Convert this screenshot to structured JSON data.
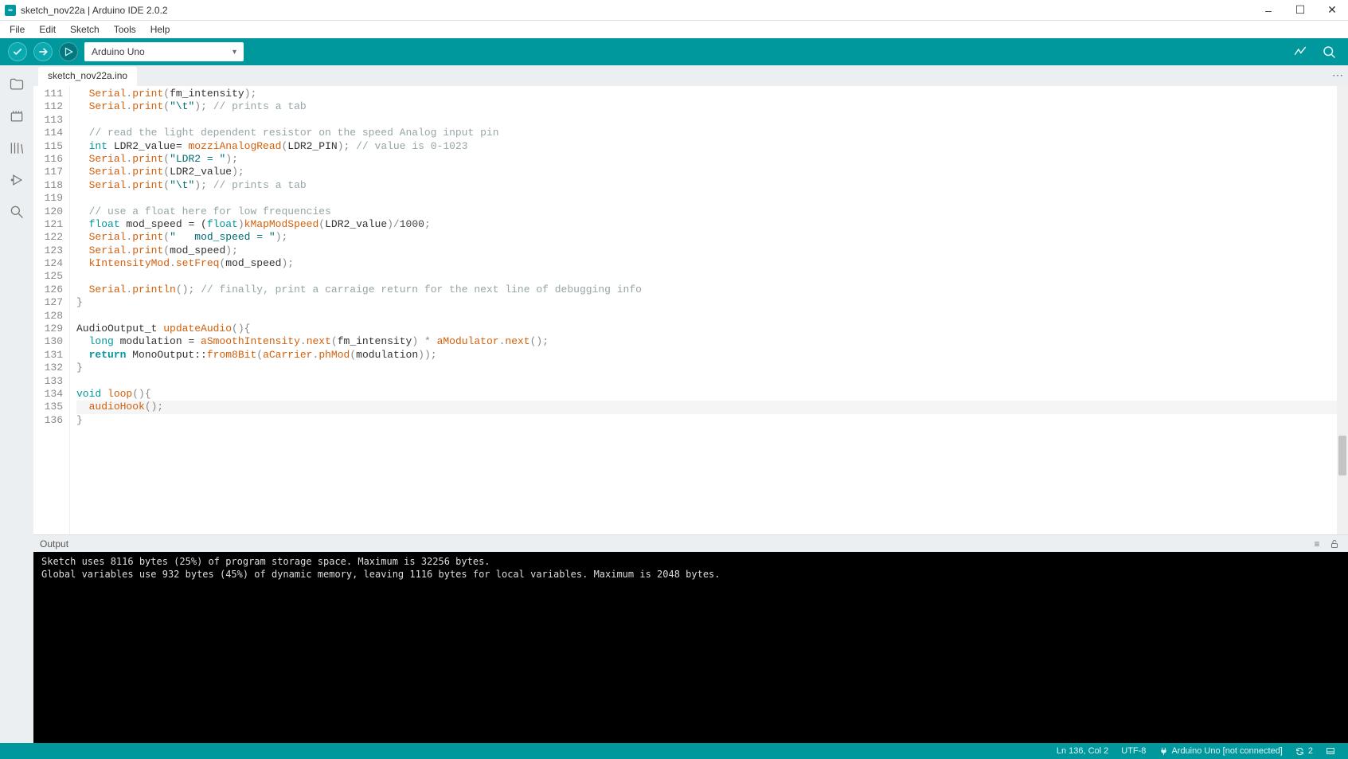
{
  "titlebar": {
    "title": "sketch_nov22a | Arduino IDE 2.0.2"
  },
  "menubar": {
    "items": [
      "File",
      "Edit",
      "Sketch",
      "Tools",
      "Help"
    ]
  },
  "toolbar": {
    "board_selected": "Arduino Uno"
  },
  "tabs": {
    "active": "sketch_nov22a.ino"
  },
  "editor": {
    "first_line": 111,
    "lines": [
      [
        {
          "t": "guide"
        },
        {
          "t": "fn",
          "s": "Serial"
        },
        {
          "t": "op",
          "s": "."
        },
        {
          "t": "fn",
          "s": "print"
        },
        {
          "t": "op",
          "s": "("
        },
        {
          "t": "ident",
          "s": "fm_intensity"
        },
        {
          "t": "op",
          "s": ");"
        }
      ],
      [
        {
          "t": "guide"
        },
        {
          "t": "fn",
          "s": "Serial"
        },
        {
          "t": "op",
          "s": "."
        },
        {
          "t": "fn",
          "s": "print"
        },
        {
          "t": "op",
          "s": "("
        },
        {
          "t": "str",
          "s": "\"\\t\""
        },
        {
          "t": "op",
          "s": "); "
        },
        {
          "t": "cmt",
          "s": "// prints a tab"
        }
      ],
      [
        {
          "t": "ident",
          "s": ""
        }
      ],
      [
        {
          "t": "guide"
        },
        {
          "t": "cmt",
          "s": "// read the light dependent resistor on the speed Analog input pin"
        }
      ],
      [
        {
          "t": "guide"
        },
        {
          "t": "type",
          "s": "int"
        },
        {
          "t": "ident",
          "s": " LDR2_value= "
        },
        {
          "t": "fn",
          "s": "mozziAnalogRead"
        },
        {
          "t": "op",
          "s": "("
        },
        {
          "t": "ident",
          "s": "LDR2_PIN"
        },
        {
          "t": "op",
          "s": "); "
        },
        {
          "t": "cmt",
          "s": "// value is 0-1023"
        }
      ],
      [
        {
          "t": "guide"
        },
        {
          "t": "fn",
          "s": "Serial"
        },
        {
          "t": "op",
          "s": "."
        },
        {
          "t": "fn",
          "s": "print"
        },
        {
          "t": "op",
          "s": "("
        },
        {
          "t": "str",
          "s": "\"LDR2 = \""
        },
        {
          "t": "op",
          "s": ");"
        }
      ],
      [
        {
          "t": "guide"
        },
        {
          "t": "fn",
          "s": "Serial"
        },
        {
          "t": "op",
          "s": "."
        },
        {
          "t": "fn",
          "s": "print"
        },
        {
          "t": "op",
          "s": "("
        },
        {
          "t": "ident",
          "s": "LDR2_value"
        },
        {
          "t": "op",
          "s": ");"
        }
      ],
      [
        {
          "t": "guide"
        },
        {
          "t": "fn",
          "s": "Serial"
        },
        {
          "t": "op",
          "s": "."
        },
        {
          "t": "fn",
          "s": "print"
        },
        {
          "t": "op",
          "s": "("
        },
        {
          "t": "str",
          "s": "\"\\t\""
        },
        {
          "t": "op",
          "s": "); "
        },
        {
          "t": "cmt",
          "s": "// prints a tab"
        }
      ],
      [
        {
          "t": "ident",
          "s": ""
        }
      ],
      [
        {
          "t": "guide"
        },
        {
          "t": "cmt",
          "s": "// use a float here for low frequencies"
        }
      ],
      [
        {
          "t": "guide"
        },
        {
          "t": "type",
          "s": "float"
        },
        {
          "t": "ident",
          "s": " mod_speed = ("
        },
        {
          "t": "type",
          "s": "float"
        },
        {
          "t": "op",
          "s": ")"
        },
        {
          "t": "fn",
          "s": "kMapModSpeed"
        },
        {
          "t": "op",
          "s": "("
        },
        {
          "t": "ident",
          "s": "LDR2_value"
        },
        {
          "t": "op",
          "s": ")/"
        },
        {
          "t": "num",
          "s": "1000"
        },
        {
          "t": "op",
          "s": ";"
        }
      ],
      [
        {
          "t": "guide"
        },
        {
          "t": "fn",
          "s": "Serial"
        },
        {
          "t": "op",
          "s": "."
        },
        {
          "t": "fn",
          "s": "print"
        },
        {
          "t": "op",
          "s": "("
        },
        {
          "t": "str",
          "s": "\"   mod_speed = \""
        },
        {
          "t": "op",
          "s": ");"
        }
      ],
      [
        {
          "t": "guide"
        },
        {
          "t": "fn",
          "s": "Serial"
        },
        {
          "t": "op",
          "s": "."
        },
        {
          "t": "fn",
          "s": "print"
        },
        {
          "t": "op",
          "s": "("
        },
        {
          "t": "ident",
          "s": "mod_speed"
        },
        {
          "t": "op",
          "s": ");"
        }
      ],
      [
        {
          "t": "guide"
        },
        {
          "t": "fn",
          "s": "kIntensityMod"
        },
        {
          "t": "op",
          "s": "."
        },
        {
          "t": "fn",
          "s": "setFreq"
        },
        {
          "t": "op",
          "s": "("
        },
        {
          "t": "ident",
          "s": "mod_speed"
        },
        {
          "t": "op",
          "s": ");"
        }
      ],
      [
        {
          "t": "ident",
          "s": ""
        }
      ],
      [
        {
          "t": "guide"
        },
        {
          "t": "fn",
          "s": "Serial"
        },
        {
          "t": "op",
          "s": "."
        },
        {
          "t": "fn",
          "s": "println"
        },
        {
          "t": "op",
          "s": "(); "
        },
        {
          "t": "cmt",
          "s": "// finally, print a carraige return for the next line of debugging info"
        }
      ],
      [
        {
          "t": "op",
          "s": "}"
        }
      ],
      [
        {
          "t": "ident",
          "s": ""
        }
      ],
      [
        {
          "t": "ident",
          "s": "AudioOutput_t "
        },
        {
          "t": "fn",
          "s": "updateAudio"
        },
        {
          "t": "op",
          "s": "(){"
        }
      ],
      [
        {
          "t": "guide"
        },
        {
          "t": "type",
          "s": "long"
        },
        {
          "t": "ident",
          "s": " modulation = "
        },
        {
          "t": "fn",
          "s": "aSmoothIntensity"
        },
        {
          "t": "op",
          "s": "."
        },
        {
          "t": "fn",
          "s": "next"
        },
        {
          "t": "op",
          "s": "("
        },
        {
          "t": "ident",
          "s": "fm_intensity"
        },
        {
          "t": "op",
          "s": ") * "
        },
        {
          "t": "fn",
          "s": "aModulator"
        },
        {
          "t": "op",
          "s": "."
        },
        {
          "t": "fn",
          "s": "next"
        },
        {
          "t": "op",
          "s": "();"
        }
      ],
      [
        {
          "t": "guide"
        },
        {
          "t": "kw",
          "s": "return"
        },
        {
          "t": "ident",
          "s": " MonoOutput::"
        },
        {
          "t": "fn",
          "s": "from8Bit"
        },
        {
          "t": "op",
          "s": "("
        },
        {
          "t": "fn",
          "s": "aCarrier"
        },
        {
          "t": "op",
          "s": "."
        },
        {
          "t": "fn",
          "s": "phMod"
        },
        {
          "t": "op",
          "s": "("
        },
        {
          "t": "ident",
          "s": "modulation"
        },
        {
          "t": "op",
          "s": "));"
        }
      ],
      [
        {
          "t": "op",
          "s": "}"
        }
      ],
      [
        {
          "t": "ident",
          "s": ""
        }
      ],
      [
        {
          "t": "type",
          "s": "void"
        },
        {
          "t": "ident",
          "s": " "
        },
        {
          "t": "fn",
          "s": "loop"
        },
        {
          "t": "op",
          "s": "(){"
        }
      ],
      [
        {
          "t": "guide"
        },
        {
          "t": "fn",
          "s": "audioHook"
        },
        {
          "t": "op",
          "s": "();"
        }
      ],
      [
        {
          "t": "op",
          "s": "}"
        }
      ]
    ],
    "highlight_line": 135
  },
  "output": {
    "title": "Output",
    "lines": [
      "Sketch uses 8116 bytes (25%) of program storage space. Maximum is 32256 bytes.",
      "Global variables use 932 bytes (45%) of dynamic memory, leaving 1116 bytes for local variables. Maximum is 2048 bytes."
    ]
  },
  "statusbar": {
    "cursor": "Ln 136, Col 2",
    "encoding": "UTF-8",
    "board": "Arduino Uno [not connected]",
    "notifications": "2"
  }
}
